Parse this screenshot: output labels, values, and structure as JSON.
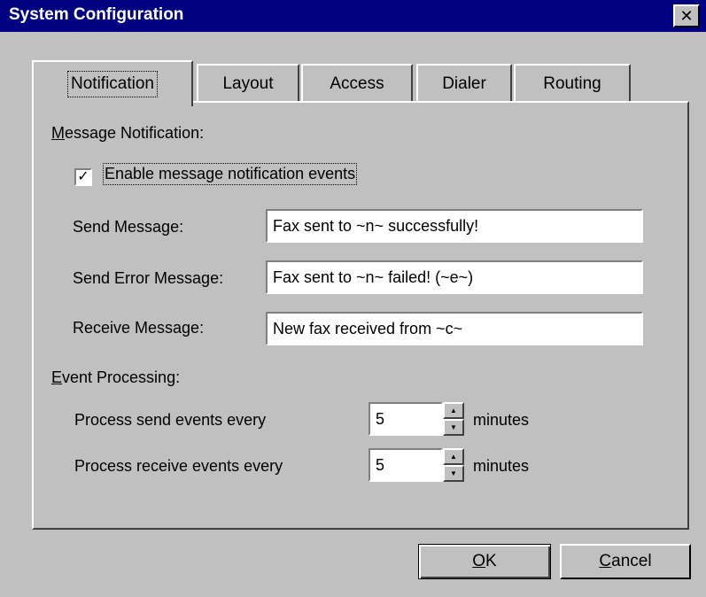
{
  "window": {
    "title": "System Configuration",
    "close_glyph": "✕"
  },
  "tabs": [
    {
      "label": "Notification",
      "active": true
    },
    {
      "label": "Layout",
      "active": false
    },
    {
      "label": "Access",
      "active": false
    },
    {
      "label": "Dialer",
      "active": false
    },
    {
      "label": "Routing",
      "active": false
    }
  ],
  "message_notification": {
    "heading_mnemonic": "M",
    "heading_rest": "essage Notification:",
    "enable_checkbox": {
      "label": "Enable message notification events",
      "checked": true,
      "check_glyph": "✓"
    },
    "send_message": {
      "label": "Send Message:",
      "value": "Fax sent to ~n~ successfully!"
    },
    "send_error_message": {
      "label": "Send Error Message:",
      "value": "Fax sent to ~n~ failed! (~e~)"
    },
    "receive_message": {
      "label": "Receive Message:",
      "value": "New fax received from ~c~"
    }
  },
  "event_processing": {
    "heading_mnemonic": "E",
    "heading_rest": "vent Processing:",
    "send_events": {
      "label": "Process send events every",
      "value": "5",
      "unit": "minutes"
    },
    "receive_events": {
      "label": "Process receive events every",
      "value": "5",
      "unit": "minutes"
    }
  },
  "buttons": {
    "ok": {
      "mnemonic": "O",
      "rest": "K"
    },
    "cancel": {
      "mnemonic": "C",
      "rest": "ancel"
    }
  },
  "icons": {
    "spin_up": "▲",
    "spin_down": "▼"
  }
}
